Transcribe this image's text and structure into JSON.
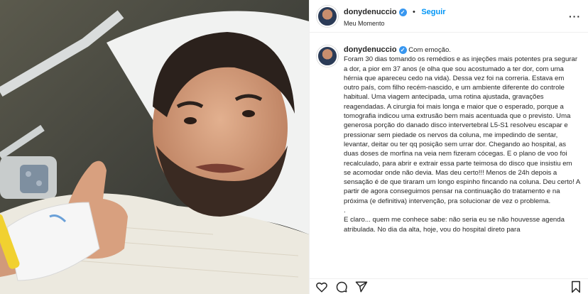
{
  "post": {
    "username": "donydenuccio",
    "follow_label": "Seguir",
    "separator": "•",
    "location": "Meu Momento",
    "more_label": "···"
  },
  "caption": {
    "username": "donydenuccio",
    "lead": "Com emoção.",
    "p1": "Foram 30 dias tomando os remédios e as injeções mais potentes pra segurar a dor, a pior em 37 anos (e olha que sou acostumado a ter dor, com uma hérnia que apareceu cedo na vida). Dessa vez foi na correria. Estava em outro país, com filho recém-nascido, e um ambiente diferente do controle habitual. Uma viagem antecipada, uma rotina ajustada, gravações reagendadas. A cirurgia foi mais longa e maior que o esperado, porque a tomografia indicou uma extrusão bem mais acentuada que o previsto. Uma generosa porção do danado disco intervertebral L5-S1 resolveu escapar e pressionar sem piedade os nervos da coluna, me impedindo de sentar, levantar, deitar ou ter qq posição sem urrar dor. Chegando ao hospital, as duas doses de morfina na veia nem fizeram cócegas. E o plano de voo foi recalculado, para abrir e extrair essa parte teimosa do disco que insistiu em se acomodar onde não devia. Mas deu certo!!! Menos de 24h depois a sensação é de que tiraram um longo espinho fincando na coluna. Deu certo! A partir de agora conseguimos pensar na continuação do tratamento e na próxima (e definitiva) intervenção, pra solucionar de vez o problema.",
    "dot": ".",
    "p2": "E claro... quem me conhece sabe: não seria eu se não houvesse agenda atribulada. No dia da alta, hoje, vou do hospital direto para"
  },
  "icons": [
    "verified-badge-icon",
    "more-options-icon",
    "heart-icon",
    "comment-icon",
    "share-icon",
    "save-icon"
  ]
}
